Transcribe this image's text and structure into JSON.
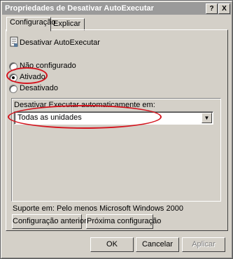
{
  "window": {
    "title": "Propriedades de Desativar AutoExecutar",
    "help_button": "?",
    "close_button": "X"
  },
  "tabs": [
    {
      "label": "Configuração",
      "active": true
    },
    {
      "label": "Explicar",
      "active": false
    }
  ],
  "setting": {
    "icon": "policy-document-icon",
    "name": "Desativar AutoExecutar"
  },
  "options": [
    {
      "label": "Não configurado",
      "selected": false
    },
    {
      "label": "Ativado",
      "selected": true
    },
    {
      "label": "Desativado",
      "selected": false
    }
  ],
  "group": {
    "label": "Desativar Executar automaticamente em:",
    "select_value": "Todas as unidades"
  },
  "support_text": "Suporte em: Pelo menos Microsoft Windows 2000",
  "nav_buttons": {
    "previous": "Configuração anterior",
    "next": "Próxima configuração"
  },
  "dialog_buttons": {
    "ok": "OK",
    "cancel": "Cancelar",
    "apply": "Aplicar"
  },
  "colors": {
    "annotation": "#d4141e",
    "dialog_face": "#d4d0c8",
    "title_bar": "#9a9a9a"
  }
}
